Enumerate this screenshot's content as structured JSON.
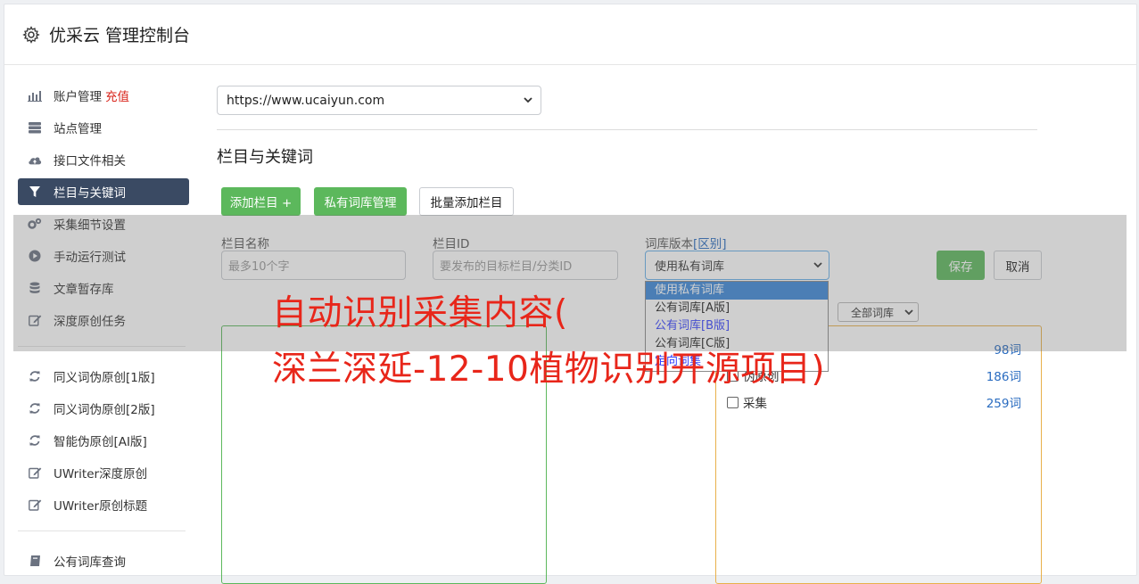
{
  "header": {
    "title": "优采云 管理控制台",
    "icon": "gear-icon"
  },
  "sidebar": {
    "items": [
      {
        "label": "账户管理",
        "icon": "bar-chart-icon",
        "extra": "充值"
      },
      {
        "label": "站点管理",
        "icon": "server-icon"
      },
      {
        "label": "接口文件相关",
        "icon": "cloud-upload-icon"
      },
      {
        "label": "栏目与关键词",
        "icon": "filter-icon",
        "active": true
      },
      {
        "label": "采集细节设置",
        "icon": "cogs-icon"
      },
      {
        "label": "手动运行测试",
        "icon": "play-circle-icon"
      },
      {
        "label": "文章暂存库",
        "icon": "database-icon"
      },
      {
        "label": "深度原创任务",
        "icon": "edit-icon"
      },
      {
        "label": "同义词伪原创[1版]",
        "icon": "refresh-icon"
      },
      {
        "label": "同义词伪原创[2版]",
        "icon": "refresh-icon"
      },
      {
        "label": "智能伪原创[AI版]",
        "icon": "refresh-icon"
      },
      {
        "label": "UWriter深度原创",
        "icon": "edit-icon"
      },
      {
        "label": "UWriter原创标题",
        "icon": "edit-icon"
      },
      {
        "label": "公有词库查询",
        "icon": "book-icon"
      }
    ]
  },
  "main": {
    "site_select": "https://www.ucaiyun.com",
    "section_title": "栏目与关键词",
    "buttons": {
      "add_column": "添加栏目 +",
      "private_lib": "私有词库管理",
      "batch_add": "批量添加栏目"
    },
    "form": {
      "name_label": "栏目名称",
      "name_placeholder": "最多10个字",
      "id_label": "栏目ID",
      "id_placeholder": "要发布的目标栏目/分类ID",
      "lib_label": "词库版本",
      "lib_diff": "[区别]",
      "lib_selected": "使用私有词库",
      "save": "保存",
      "cancel": "取消"
    },
    "dropdown_options": [
      "使用私有词库",
      "公有词库[A版]",
      "公有词库[B版]",
      "公有词库[C版]",
      "定向词集"
    ],
    "filter_select": "全部词库",
    "keyword_groups": [
      {
        "label": "",
        "count": "98词"
      },
      {
        "label": "伪原创",
        "count": "186词"
      },
      {
        "label": "采集",
        "count": "259词"
      }
    ]
  },
  "watermark": {
    "line1": "自动识别采集内容(",
    "line2": "深兰深延-12-10植物识别开源项目)"
  },
  "colors": {
    "accent_green": "#5cb85c",
    "sidebar_active": "#3a4a63",
    "watermark_red": "#e8261a"
  }
}
